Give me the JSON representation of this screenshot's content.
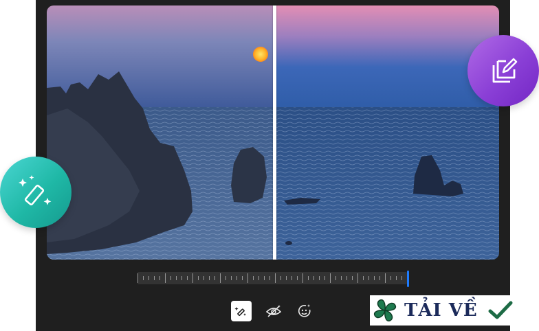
{
  "photo": {
    "before_label": "",
    "after_label": ""
  },
  "timeline": {
    "position_fraction": 1.0
  },
  "toolbar": {
    "buttons": [
      {
        "icon": "magic-wand-icon",
        "active": true
      },
      {
        "icon": "eye-sparkle-icon",
        "active": false
      },
      {
        "icon": "face-sparkle-icon",
        "active": false
      }
    ]
  },
  "badges": {
    "left_icon": "magic-eraser-icon",
    "right_icon": "edit-layers-icon",
    "left_color": "#1fb8a6",
    "right_color": "#8a3fd6"
  },
  "watermark": {
    "text": "TẢI VỀ",
    "logo": "clover-logo",
    "check": "checkmark-icon"
  },
  "colors": {
    "frame": "#1f1f1f",
    "accent": "#1e7cff"
  }
}
